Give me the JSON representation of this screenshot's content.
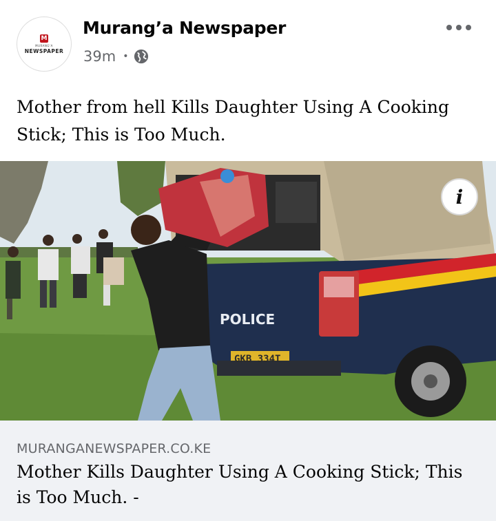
{
  "post": {
    "page_name": "Murang’a Newspaper",
    "time_ago": "39m",
    "separator": "•",
    "caption": "Mother from hell Kills Daughter Using A Cooking Stick; This is Too Much.",
    "avatar": {
      "badge": "M",
      "subtext": "MURANG'A",
      "word": "NEWSPAPER"
    },
    "photo": {
      "vehicle_text": "POLICE",
      "plate": "GKB 334T",
      "info_glyph": "i"
    },
    "link_preview": {
      "domain": "MURANGANEWSPAPER.CO.KE",
      "title": "Mother Kills Daughter Using A Cooking Stick; This is Too Much. -"
    }
  },
  "colors": {
    "text_primary": "#050505",
    "text_secondary": "#65676b",
    "link_bg": "#f0f2f5",
    "vehicle_blue": "#1f2f4e",
    "stripe_red": "#d1242b",
    "stripe_yellow": "#f2c418",
    "grass": "#6f9a43",
    "sky": "#dfe8ee"
  },
  "icons": {
    "visibility": "globe-icon",
    "menu": "more-options-icon",
    "info": "info-icon"
  }
}
